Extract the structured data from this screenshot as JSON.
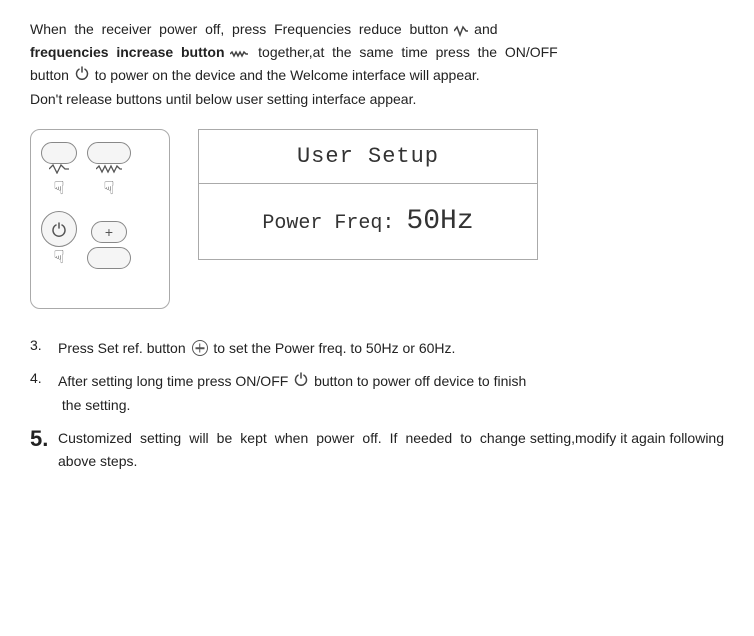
{
  "intro": {
    "line1": "When  the  receiver  power  off,  press  Frequencies  reduce  button",
    "line2_bold": "frequencies  increase  button",
    "line2_rest": "together,at  the  same  time  press  the  ON/OFF",
    "line3": "button",
    "line3_rest": "to power on the device and the Welcome interface will appear.",
    "line4": "Don't release buttons until below user setting interface appear."
  },
  "setup_box": {
    "title": "User Setup",
    "freq_label": "Power Freq:",
    "freq_value": "50Hz"
  },
  "steps": [
    {
      "number": "3.",
      "large": false,
      "text": "Press Set ref. button",
      "text_after": "to set the Power freq. to 50Hz or 60Hz."
    },
    {
      "number": "4.",
      "large": false,
      "text": "After setting long time press ON/OFF",
      "text_after": "button to power off device to finish the setting."
    },
    {
      "number": "5.",
      "large": true,
      "text": "Customized  setting  will  be  kept  when  power  off.  If  needed  to  change setting,modify it again following above steps."
    }
  ]
}
